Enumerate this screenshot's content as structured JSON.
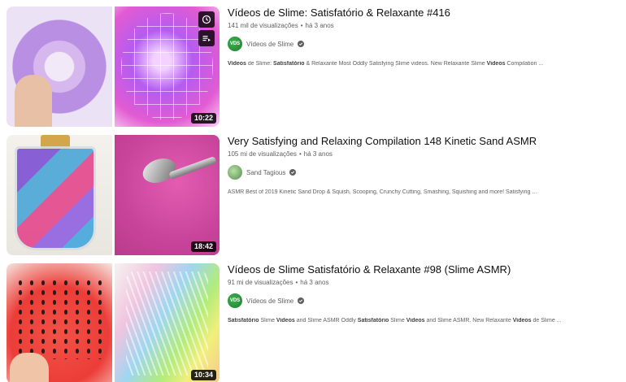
{
  "results": [
    {
      "title": "Vídeos de Slime: Satisfatório & Relaxante #416",
      "views": "141 mil de visualizações",
      "age": "há 3 anos",
      "channel": "Vídeos de Slime",
      "avatar_text": "VDS",
      "description_parts": [
        {
          "text": "Vídeos",
          "bold": true
        },
        {
          "text": " de Slime: ",
          "bold": false
        },
        {
          "text": "Satisfatório",
          "bold": true
        },
        {
          "text": " & Relaxante Most Oddly Satisfying Slime videos. New Relaxante Slime ",
          "bold": false
        },
        {
          "text": "Videos",
          "bold": true
        },
        {
          "text": " Compilation ...",
          "bold": false
        }
      ],
      "duration": "10:22",
      "hover_icons": [
        "watch-later-icon",
        "add-to-queue-icon"
      ]
    },
    {
      "title": "Very Satisfying and Relaxing Compilation 148 Kinetic Sand ASMR",
      "views": "105 mi de visualizações",
      "age": "há 3 anos",
      "channel": "Sand Tagious",
      "avatar_text": "",
      "description_parts": [
        {
          "text": "ASMR Best of 2019 Kinetic Sand Drop & Squish, Scooping, Crunchy Cutting, Smashing, Squishing and more! Satisfying ...",
          "bold": false
        }
      ],
      "duration": "18:42",
      "hover_icons": []
    },
    {
      "title": "Vídeos de Slime Satisfatório & Relaxante #98 (Slime ASMR)",
      "views": "91 mi de visualizações",
      "age": "há 3 anos",
      "channel": "Vídeos de Slime",
      "avatar_text": "VDS",
      "description_parts": [
        {
          "text": "Satisfatório",
          "bold": true
        },
        {
          "text": " Slime ",
          "bold": false
        },
        {
          "text": "Videos",
          "bold": true
        },
        {
          "text": " and Slime ASMR Oddly ",
          "bold": false
        },
        {
          "text": "Satisfatório",
          "bold": true
        },
        {
          "text": " Slime ",
          "bold": false
        },
        {
          "text": "Videos",
          "bold": true
        },
        {
          "text": " and Slime ASMR. New Relaxante ",
          "bold": false
        },
        {
          "text": "Videos",
          "bold": true
        },
        {
          "text": " de Slime ...",
          "bold": false
        }
      ],
      "duration": "10:34",
      "hover_icons": []
    }
  ],
  "colors": {
    "verified": "#606060",
    "duration_bg": "#000000",
    "avatar_green": "#1c7d2e"
  }
}
